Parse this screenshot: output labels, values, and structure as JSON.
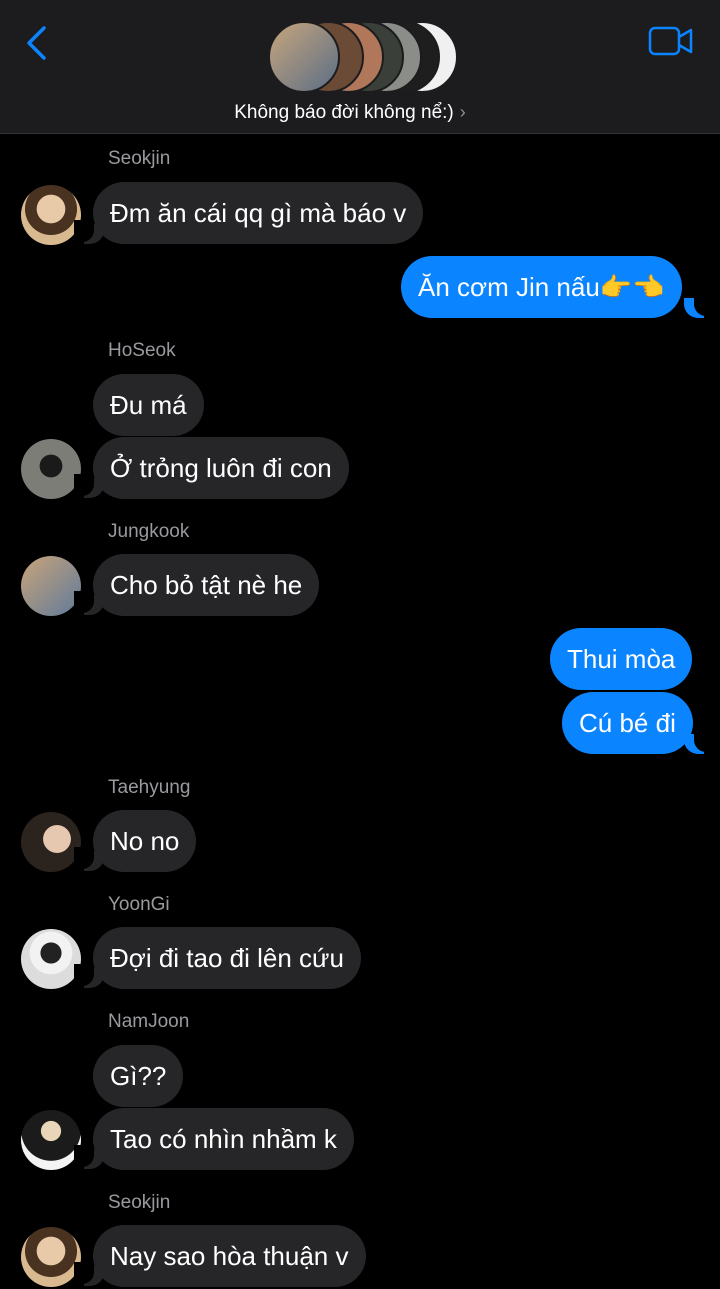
{
  "header": {
    "title": "Không báo đời không nể:)",
    "back_icon": "chevron-left-icon",
    "video_icon": "video-camera-icon",
    "accent": "#0a84ff"
  },
  "messages": [
    {
      "sender": "Seokjin",
      "text": "Đm ăn cái qq gì mà báo v"
    },
    {
      "sender": "me",
      "text": "Ăn cơm Jin nấu👉👈"
    },
    {
      "sender": "HoSeok",
      "text": "Đu má"
    },
    {
      "sender": "HoSeok",
      "text": "Ở trỏng luôn đi con"
    },
    {
      "sender": "Jungkook",
      "text": "Cho bỏ tật nè he"
    },
    {
      "sender": "me",
      "text": "Thui mòa"
    },
    {
      "sender": "me",
      "text": "Cú bé đi"
    },
    {
      "sender": "Taehyung",
      "text": "No no"
    },
    {
      "sender": "YoonGi",
      "text": "Đợi đi tao đi lên cứu"
    },
    {
      "sender": "NamJoon",
      "text": "Gì??"
    },
    {
      "sender": "NamJoon",
      "text": "Tao có nhìn nhầm k"
    },
    {
      "sender": "Seokjin",
      "text": "Nay sao hòa thuận v"
    }
  ]
}
